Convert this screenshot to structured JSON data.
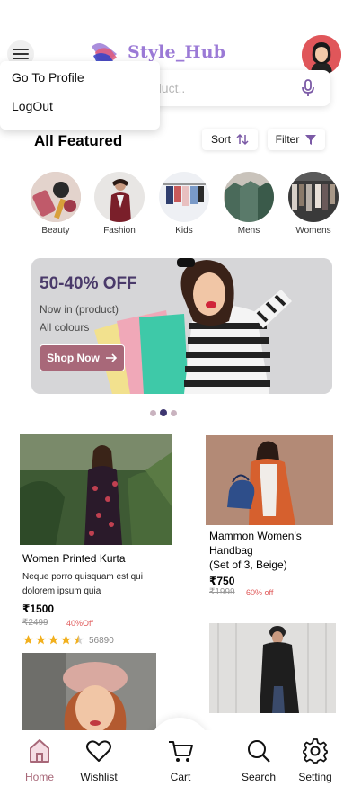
{
  "header": {
    "brand": "Style_Hub",
    "brand_color": "#9b7ad6"
  },
  "search": {
    "placeholder": "duct.."
  },
  "menu": {
    "items": [
      {
        "label": "Go To Profile"
      },
      {
        "label": "LogOut"
      }
    ]
  },
  "featured": {
    "title": "All Featured",
    "sort_label": "Sort",
    "filter_label": "Filter"
  },
  "categories": [
    {
      "label": "Beauty"
    },
    {
      "label": "Fashion"
    },
    {
      "label": "Kids"
    },
    {
      "label": "Mens"
    },
    {
      "label": "Womens"
    }
  ],
  "banner": {
    "title": "50-40% OFF",
    "line1": "Now in (product)",
    "line2": "All colours",
    "button": "Shop Now"
  },
  "carousel": {
    "active_index": 1,
    "count": 3
  },
  "products": [
    {
      "title": "Women Printed Kurta",
      "desc1": "Neque porro quisquam est qui",
      "desc2": "dolorem ipsum quia",
      "price": "₹1500",
      "old_price": "₹2499",
      "discount": "40%Off",
      "rating": 4.5,
      "reviews": "56890"
    },
    {
      "title1": "Mammon Women's",
      "title2": "Handbag",
      "title3": "(Set of 3, Beige)",
      "price": "₹750",
      "old_price": "₹1999",
      "discount": "60% off"
    }
  ],
  "nav": [
    {
      "label": "Home",
      "active": true
    },
    {
      "label": "Wishlist"
    },
    {
      "label": "Cart"
    },
    {
      "label": "Search"
    },
    {
      "label": "Setting"
    }
  ],
  "colors": {
    "accent": "#a86879",
    "banner_title": "#4a3a6a",
    "star": "#f2b01e",
    "discount": "#e05a5a"
  }
}
